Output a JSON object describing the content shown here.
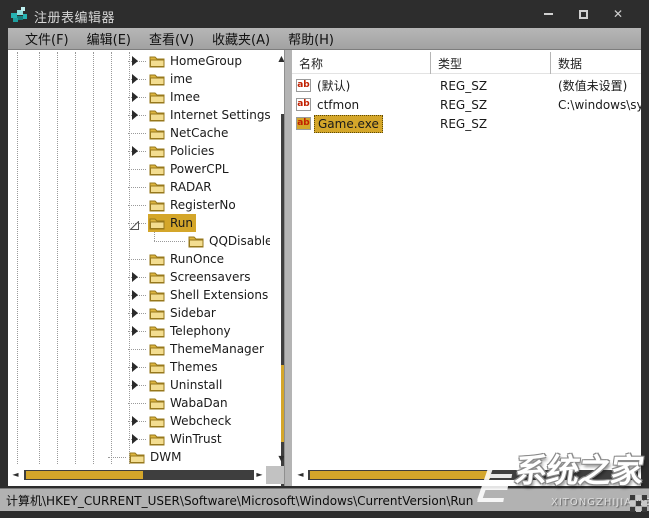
{
  "window": {
    "title": "注册表编辑器"
  },
  "titlebar": {
    "icons": [
      "registry-icon",
      "minimize-icon",
      "maximize-icon",
      "close-icon"
    ],
    "close_glyph": "✕"
  },
  "menu": {
    "items": [
      {
        "label": "文件(F)"
      },
      {
        "label": "编辑(E)"
      },
      {
        "label": "查看(V)"
      },
      {
        "label": "收藏夹(A)"
      },
      {
        "label": "帮助(H)"
      }
    ]
  },
  "tree": {
    "items": [
      {
        "label": "HomeGroup",
        "depth": 1,
        "expand": "collapsed",
        "selected": false
      },
      {
        "label": "ime",
        "depth": 1,
        "expand": "collapsed",
        "selected": false
      },
      {
        "label": "Imee",
        "depth": 1,
        "expand": "collapsed",
        "selected": false
      },
      {
        "label": "Internet Settings",
        "depth": 1,
        "expand": "collapsed",
        "selected": false
      },
      {
        "label": "NetCache",
        "depth": 1,
        "expand": "none",
        "selected": false
      },
      {
        "label": "Policies",
        "depth": 1,
        "expand": "collapsed",
        "selected": false
      },
      {
        "label": "PowerCPL",
        "depth": 1,
        "expand": "none",
        "selected": false
      },
      {
        "label": "RADAR",
        "depth": 1,
        "expand": "none",
        "selected": false
      },
      {
        "label": "RegisterNo",
        "depth": 1,
        "expand": "none",
        "selected": false
      },
      {
        "label": "Run",
        "depth": 1,
        "expand": "expanded",
        "selected": true
      },
      {
        "label": "QQDisabled",
        "depth": 2,
        "expand": "none",
        "selected": false
      },
      {
        "label": "RunOnce",
        "depth": 1,
        "expand": "none",
        "selected": false
      },
      {
        "label": "Screensavers",
        "depth": 1,
        "expand": "collapsed",
        "selected": false
      },
      {
        "label": "Shell Extensions",
        "depth": 1,
        "expand": "collapsed",
        "selected": false
      },
      {
        "label": "Sidebar",
        "depth": 1,
        "expand": "collapsed",
        "selected": false
      },
      {
        "label": "Telephony",
        "depth": 1,
        "expand": "collapsed",
        "selected": false
      },
      {
        "label": "ThemeManager",
        "depth": 1,
        "expand": "none",
        "selected": false
      },
      {
        "label": "Themes",
        "depth": 1,
        "expand": "collapsed",
        "selected": false
      },
      {
        "label": "Uninstall",
        "depth": 1,
        "expand": "collapsed",
        "selected": false
      },
      {
        "label": "WabaDan",
        "depth": 1,
        "expand": "none",
        "selected": false
      },
      {
        "label": "Webcheck",
        "depth": 1,
        "expand": "collapsed",
        "selected": false
      },
      {
        "label": "WinTrust",
        "depth": 1,
        "expand": "collapsed",
        "selected": false
      },
      {
        "label": "DWM",
        "depth": 0,
        "expand": "none",
        "selected": false
      }
    ]
  },
  "list": {
    "columns": [
      {
        "label": "名称"
      },
      {
        "label": "类型"
      },
      {
        "label": "数据"
      }
    ],
    "rows": [
      {
        "icon": "reg-sz-icon",
        "name": "(默认)",
        "type": "REG_SZ",
        "data": "(数值未设置)",
        "selected": false
      },
      {
        "icon": "reg-sz-icon",
        "name": "ctfmon",
        "type": "REG_SZ",
        "data": "C:\\windows\\sys",
        "selected": false
      },
      {
        "icon": "reg-sz-icon",
        "name": "Game.exe",
        "type": "REG_SZ",
        "data": "",
        "selected": true
      }
    ],
    "icon_text": "ab"
  },
  "statusbar": {
    "path": "计算机\\HKEY_CURRENT_USER\\Software\\Microsoft\\Windows\\CurrentVersion\\Run"
  },
  "watermark": {
    "title": "系统之家",
    "subtitle": "XITONGZHIJIA.NET"
  },
  "colors": {
    "accent_gold": "#d4a62a",
    "scrollbar_track": "#3e3e3e",
    "titlebar": "#2d2d2d",
    "menubar": "#ababab",
    "statusbar": "#b2b2b2",
    "ab_icon_red": "#c22000",
    "folder_gold": "#e9c558"
  }
}
